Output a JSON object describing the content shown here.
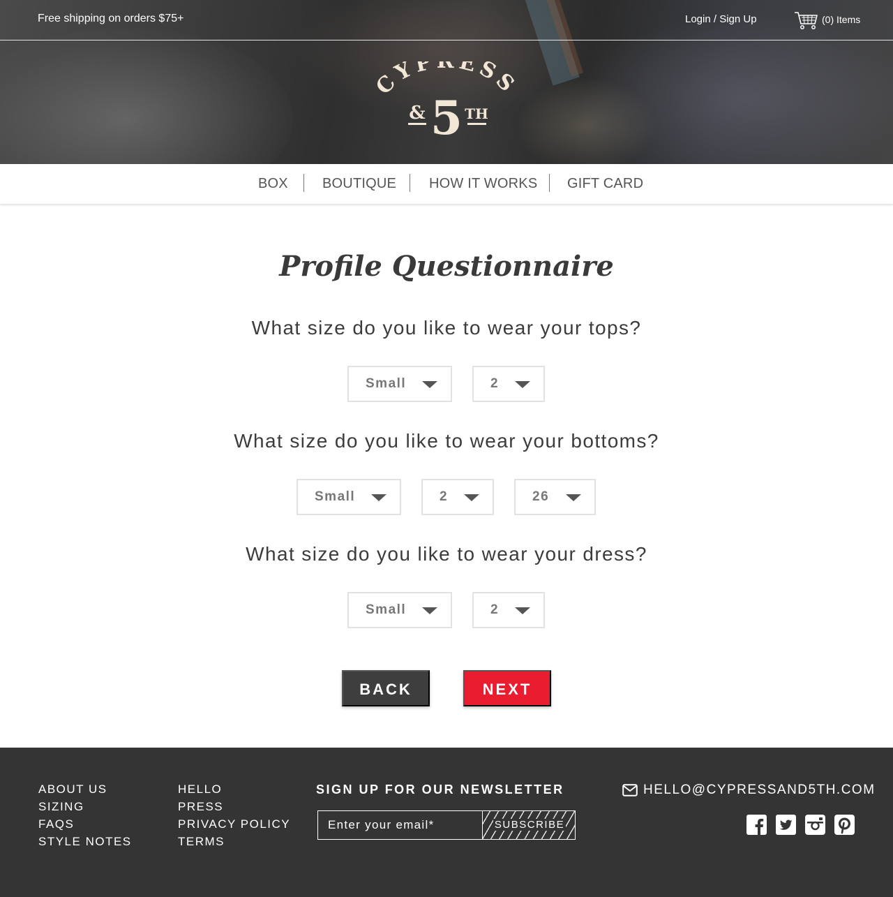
{
  "header": {
    "shipping_text": "Free shipping on orders $75+",
    "login_text": "Login / Sign Up",
    "cart_icon": "shopping-cart-icon",
    "cart_count": "(0) Items",
    "logo": {
      "top": "CYPRESS",
      "amp": "&",
      "num": "5",
      "sup": "TH"
    }
  },
  "nav": {
    "items": [
      {
        "label": "BOX"
      },
      {
        "label": "BOUTIQUE"
      },
      {
        "label": "HOW IT WORKS"
      },
      {
        "label": "GIFT CARD"
      }
    ]
  },
  "main": {
    "title": "Profile Questionnaire",
    "questions": [
      {
        "text": "What size do you like to wear your tops?",
        "selects": [
          "Small",
          "2"
        ]
      },
      {
        "text": "What size do you like to wear your bottoms?",
        "selects": [
          "Small",
          "2",
          "26"
        ]
      },
      {
        "text": "What size do you like to wear your dress?",
        "selects": [
          "Small",
          "2"
        ]
      }
    ],
    "back_label": "BACK",
    "next_label": "NEXT"
  },
  "footer": {
    "col1": [
      "ABOUT US",
      "SIZING",
      "FAQS",
      "STYLE NOTES"
    ],
    "col2": [
      "HELLO",
      "PRESS",
      "PRIVACY POLICY",
      "TERMS"
    ],
    "newsletter": {
      "heading": "SIGN UP FOR OUR NEWSLETTER",
      "placeholder": "Enter your email*",
      "button": "SUBSCRIBE"
    },
    "email": "HELLO@CYPRESSAND5TH.COM",
    "social_icons": [
      "facebook-icon",
      "twitter-icon",
      "instagram-icon",
      "pinterest-icon"
    ]
  },
  "colors": {
    "accent_red": "#ea1c2f",
    "back_button": "#3e3e3e",
    "footer_bg": "#343434",
    "logo_cream": "#f2e6d6"
  }
}
